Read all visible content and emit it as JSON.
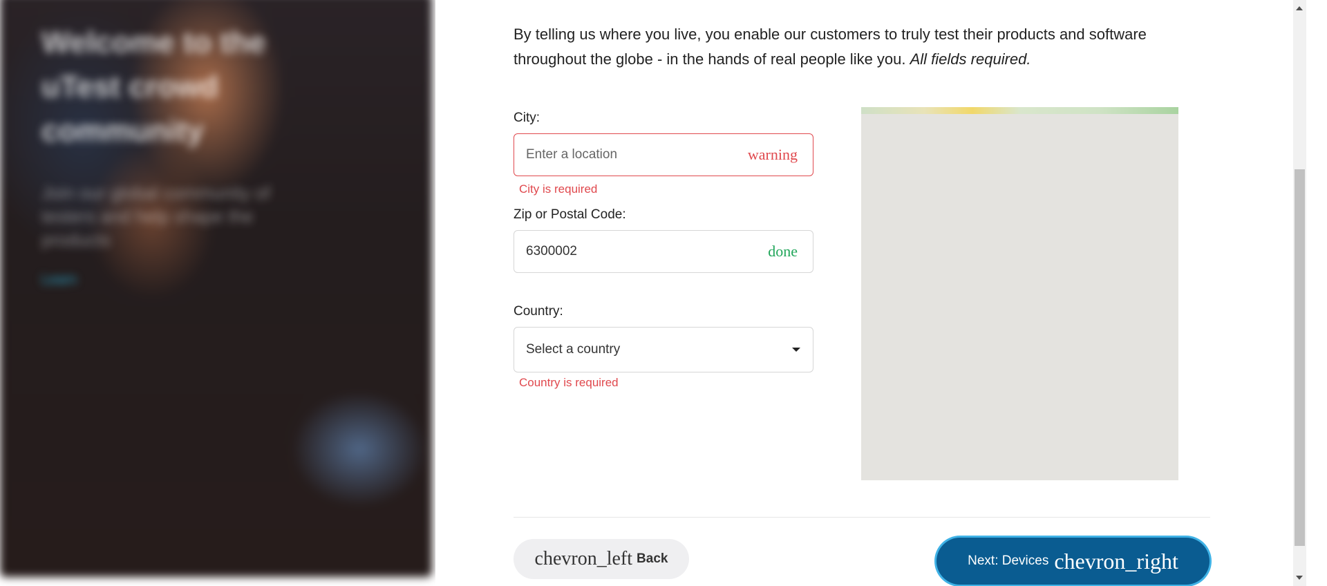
{
  "hero": {
    "title": "Welcome to the uTest crowd community",
    "subtitle": "Join our global community of testers and help shape the products",
    "link": "Learn"
  },
  "intro": {
    "text": "By telling us where you live, you enable our customers to truly test their products and software throughout the globe - in the hands of real people like you. ",
    "emphasis": "All fields required."
  },
  "city": {
    "label": "City:",
    "placeholder": "Enter a location",
    "status_icon": "warning",
    "error": "City is required"
  },
  "zip": {
    "label": "Zip or Postal Code:",
    "value": "6300002",
    "status_icon": "done"
  },
  "country": {
    "label": "Country:",
    "selected": "Select a country",
    "error": "Country is required"
  },
  "buttons": {
    "back_icon": "chevron_left",
    "back_label": "Back",
    "next_label": "Next: Devices",
    "next_icon": "chevron_right"
  },
  "colors": {
    "primary": "#0a5c91",
    "error": "#e0484d",
    "success": "#21a65a"
  }
}
